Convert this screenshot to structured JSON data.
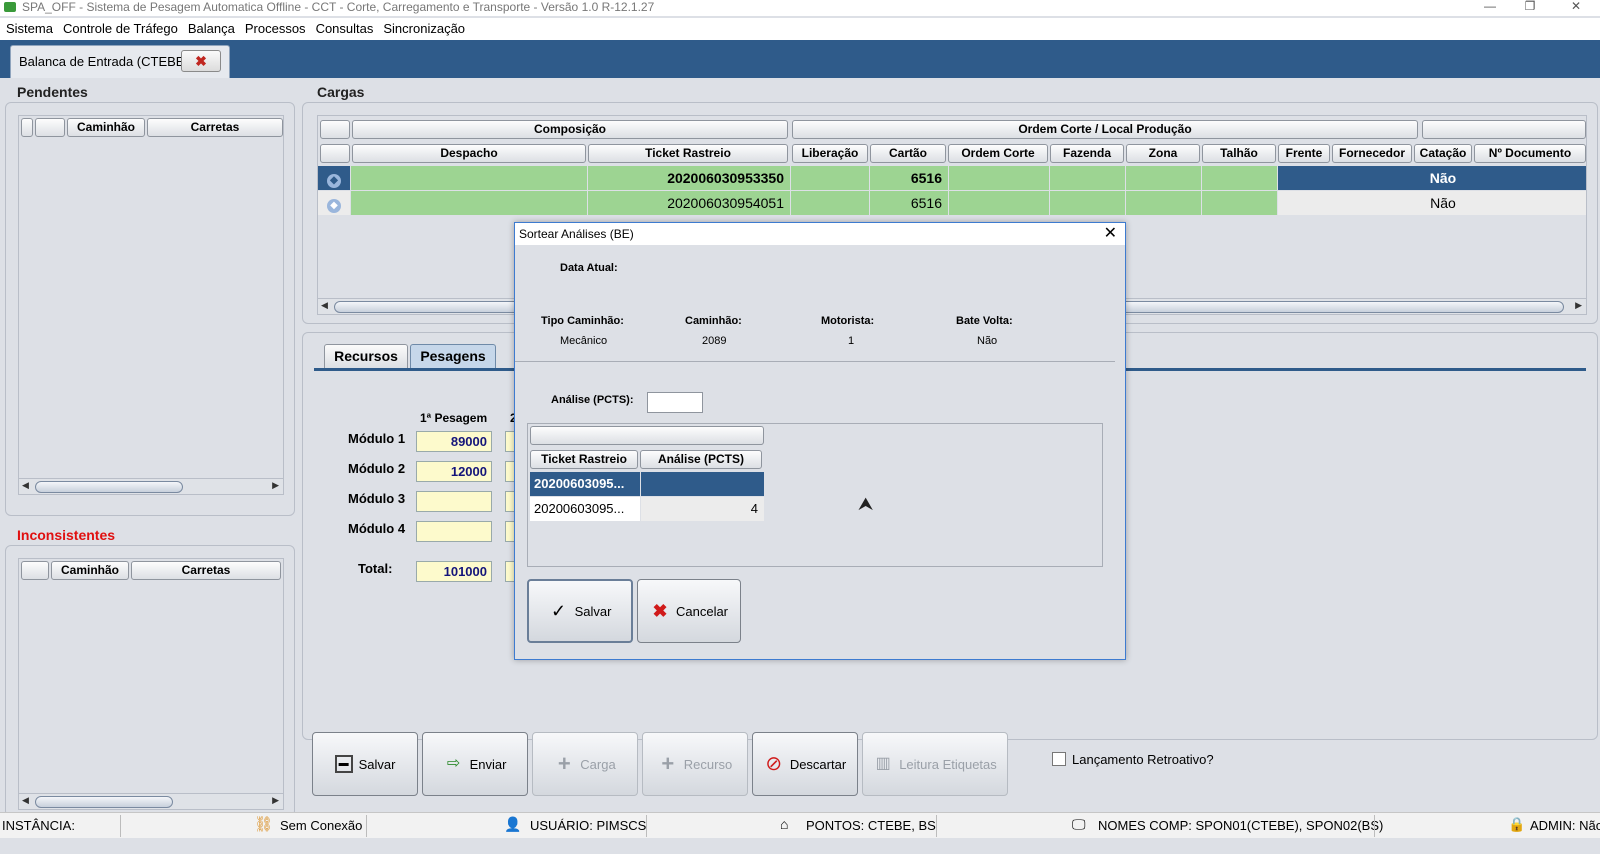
{
  "window": {
    "title": "SPA_OFF - Sistema de Pesagem Automatica Offline - CCT - Corte, Carregamento e Transporte - Versão 1.0 R-12.1.27"
  },
  "menu": [
    "Sistema",
    "Controle de Tráfego",
    "Balança",
    "Processos",
    "Consultas",
    "Sincronização"
  ],
  "doc_tab": {
    "label": "Balanca de Entrada (CTEBE)",
    "close": "✖"
  },
  "pendentes": {
    "title": "Pendentes",
    "columns": [
      "",
      "",
      "Caminhão",
      "Carretas"
    ]
  },
  "inconsistentes": {
    "title": "Inconsistentes",
    "columns": [
      "",
      "Caminhão",
      "Carretas"
    ]
  },
  "cargas": {
    "title": "Cargas",
    "group_headers": [
      "Composição",
      "Ordem Corte / Local Produção"
    ],
    "columns": [
      "Despacho",
      "Ticket Rastreio",
      "Liberação",
      "Cartão",
      "Ordem Corte",
      "Fazenda",
      "Zona",
      "Talhão",
      "Frente",
      "Fornecedor",
      "Catação",
      "Nº Documento"
    ],
    "rows": [
      {
        "ticket": "202006030953350",
        "cartao": "6516",
        "catacao": "Não"
      },
      {
        "ticket": "202006030954051",
        "cartao": "6516",
        "catacao": "Não"
      }
    ]
  },
  "subtabs": [
    "Recursos",
    "Pesagens"
  ],
  "pesagens": {
    "col_header": "1ª Pesagem",
    "col_header2": "2",
    "modules": [
      {
        "label": "Módulo 1",
        "value": "89000"
      },
      {
        "label": "Módulo 2",
        "value": "12000"
      },
      {
        "label": "Módulo 3",
        "value": ""
      },
      {
        "label": "Módulo 4",
        "value": ""
      }
    ],
    "total_label": "Total:",
    "total_value": "101000"
  },
  "actions": {
    "salvar": "Salvar",
    "enviar": "Enviar",
    "carga": "Carga",
    "recurso": "Recurso",
    "descartar": "Descartar",
    "leitura": "Leitura Etiquetas"
  },
  "retroativo_label": "Lançamento Retroativo?",
  "status": {
    "instancia": "INSTÂNCIA:",
    "conexao": "Sem Conexão",
    "usuario": "USUÁRIO: PIMSCS",
    "pontos": "PONTOS: CTEBE, BS",
    "nomes": "NOMES COMP: SPON01(CTEBE), SPON02(BS)",
    "admin": "ADMIN: Não"
  },
  "dialog": {
    "title": "Sortear Análises (BE)",
    "data_atual_label": "Data Atual:",
    "tipo_label": "Tipo Caminhão:",
    "tipo_value": "Mecânico",
    "caminhao_label": "Caminhão:",
    "caminhao_value": "2089",
    "motorista_label": "Motorista:",
    "motorista_value": "1",
    "bate_label": "Bate Volta:",
    "bate_value": "Não",
    "analise_label": "Análise (PCTS):",
    "analise_value": "",
    "table_cols": [
      "Ticket Rastreio",
      "Análise (PCTS)"
    ],
    "rows": [
      {
        "ticket": "20200603095...",
        "analise": ""
      },
      {
        "ticket": "20200603095...",
        "analise": "4"
      }
    ],
    "salvar": "Salvar",
    "cancelar": "Cancelar"
  }
}
